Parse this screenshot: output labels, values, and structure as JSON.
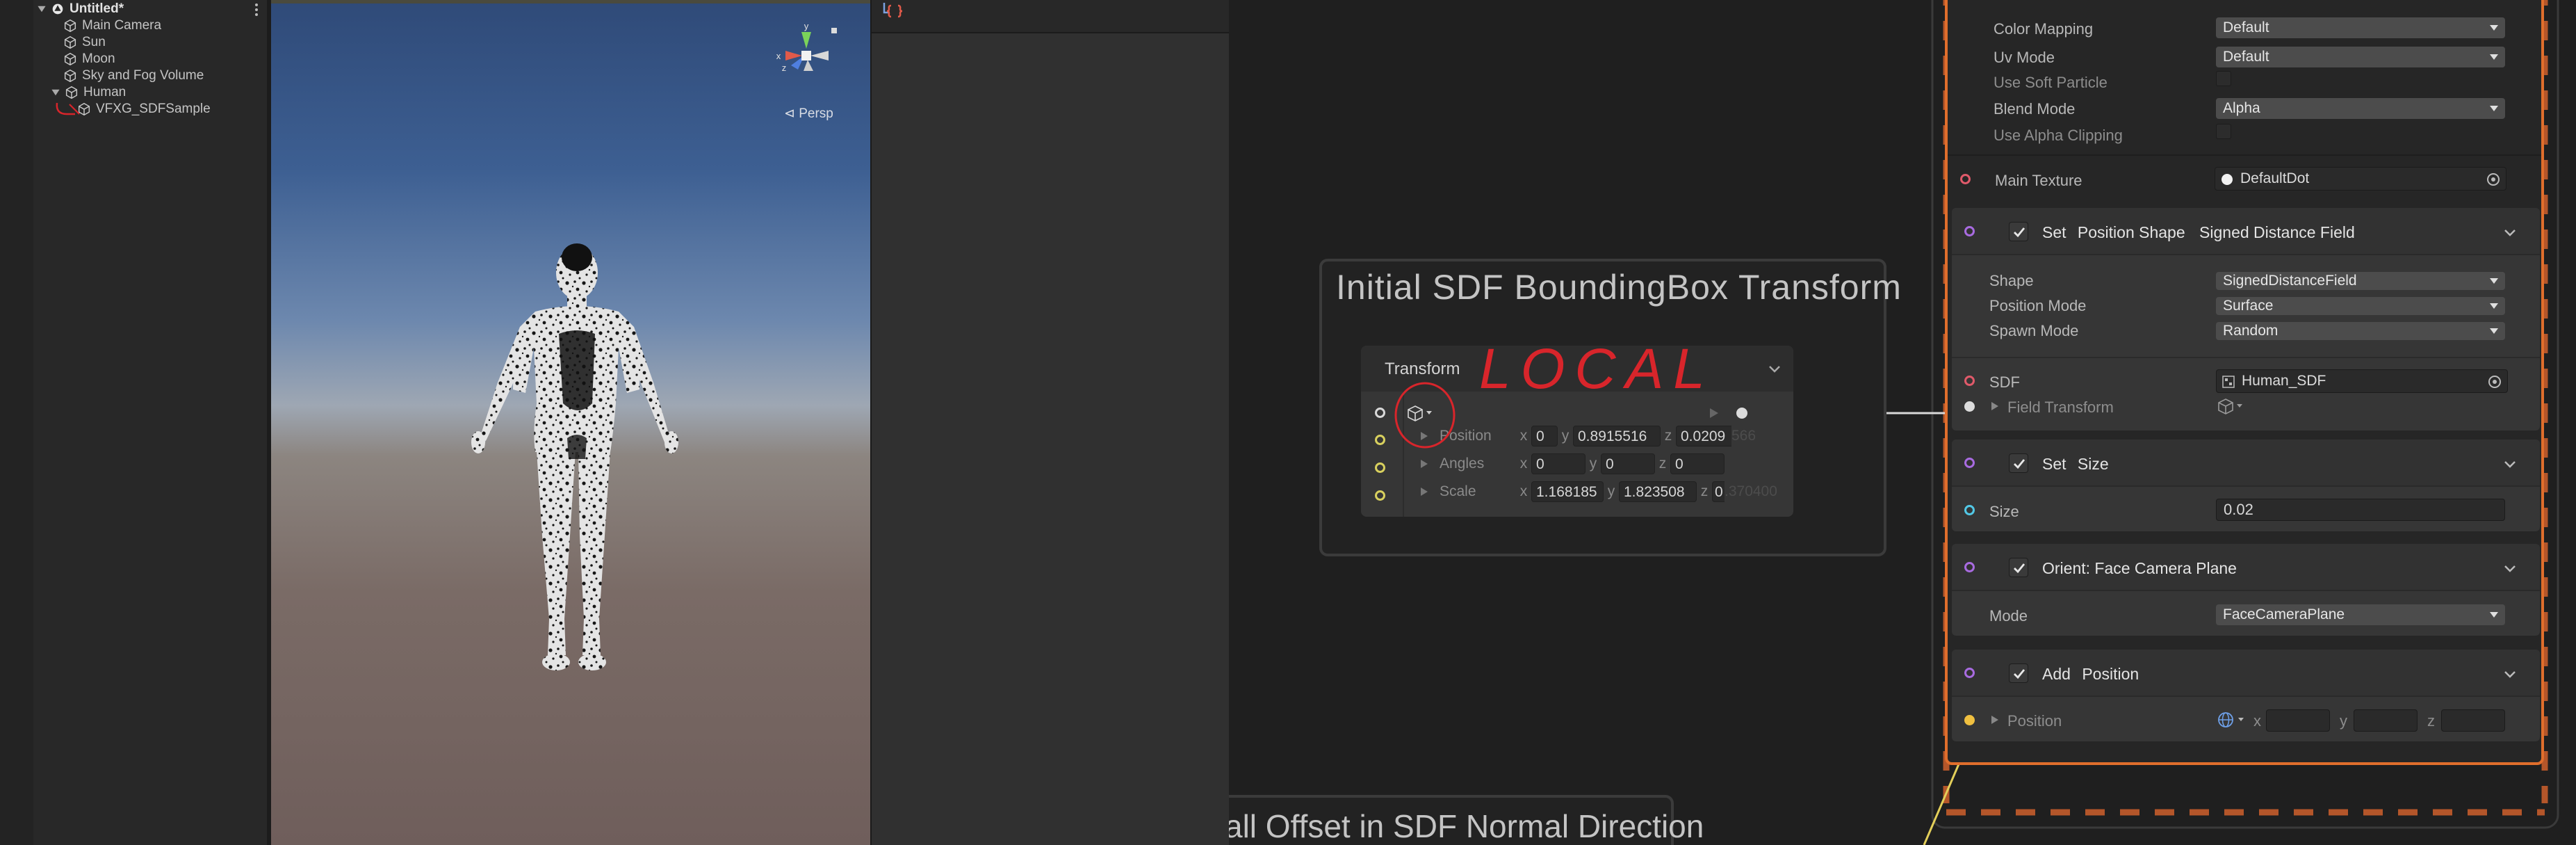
{
  "hierarchy": {
    "scene_name": "Untitled*",
    "items": [
      {
        "label": "Main Camera"
      },
      {
        "label": "Sun"
      },
      {
        "label": "Moon"
      },
      {
        "label": "Sky and Fog Volume"
      },
      {
        "label": "Human"
      },
      {
        "label": "VFXG_SDFSample"
      }
    ]
  },
  "scene": {
    "projection_label": "⊲ Persp",
    "gizmo_axes": [
      "y",
      "x",
      "z"
    ]
  },
  "graph": {
    "sticky_title": "Initial SDF BoundingBox Transform",
    "sticky2_title": "all Offset in SDF Normal Direction",
    "transform_node": {
      "title": "Transform",
      "rows": [
        {
          "label": "Position",
          "x": "0",
          "y": "0.8915516",
          "z": "0.0209",
          "z_faded": "566"
        },
        {
          "label": "Angles",
          "x": "0",
          "y": "0",
          "z": "0"
        },
        {
          "label": "Scale",
          "x": "1.168185",
          "y": "1.823508",
          "z": "0",
          "z_faded": ".370400"
        }
      ],
      "axis_x": "x",
      "axis_y": "y",
      "axis_z": "z"
    },
    "annotation_text": "LOCAL",
    "context": {
      "props": [
        {
          "label": "Color Mapping",
          "value": "Default"
        },
        {
          "label": "Uv Mode",
          "value": "Default"
        },
        {
          "label": "Use Soft Particle"
        },
        {
          "label": "Blend Mode",
          "value": "Alpha"
        },
        {
          "label": "Use Alpha Clipping"
        }
      ],
      "main_texture": {
        "label": "Main Texture",
        "value": "DefaultDot"
      },
      "blocks": {
        "set_position_shape": {
          "verb": "Set",
          "attr": "Position Shape",
          "sub": "Signed Distance Field",
          "shape": {
            "label": "Shape",
            "value": "SignedDistanceField"
          },
          "position_mode": {
            "label": "Position Mode",
            "value": "Surface"
          },
          "spawn_mode": {
            "label": "Spawn Mode",
            "value": "Random"
          },
          "sdf": {
            "label": "SDF",
            "value": "Human_SDF"
          },
          "field_transform": {
            "label": "Field Transform"
          }
        },
        "set_size": {
          "verb": "Set",
          "attr": "Size",
          "size_label": "Size",
          "size_value": "0.02"
        },
        "orient": {
          "title": "Orient: Face Camera Plane",
          "mode_label": "Mode",
          "mode_value": "FaceCameraPlane"
        },
        "add_position": {
          "verb": "Add",
          "attr": "Position",
          "pos_label": "Position",
          "ax_x": "x",
          "ax_y": "y",
          "ax_z": "z"
        }
      }
    }
  },
  "colors": {
    "context_border": "#e06e2c",
    "dashed_frame": "#b4562a",
    "annotation_red": "#d8252b",
    "port_purple": "#a86be0"
  }
}
